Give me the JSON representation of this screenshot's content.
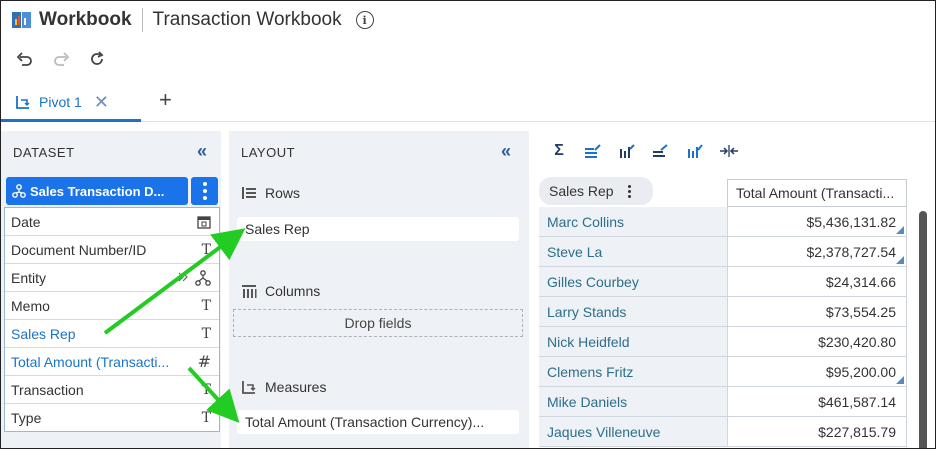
{
  "header": {
    "app_name": "Workbook",
    "doc_title": "Transaction Workbook",
    "info": "i"
  },
  "tabs": {
    "items": [
      {
        "label": "Pivot 1"
      }
    ],
    "add": "+"
  },
  "dataset": {
    "title": "DATASET",
    "collapse": "«",
    "selected": "Sales Transaction D...",
    "fields": [
      {
        "label": "Date",
        "type_icon": "calendar-icon"
      },
      {
        "label": "Document Number/ID",
        "type": "T"
      },
      {
        "label": "Entity",
        "type_icon": "hierarchy-icon"
      },
      {
        "label": "Memo",
        "type": "T"
      },
      {
        "label": "Sales Rep",
        "type": "T"
      },
      {
        "label": "Total Amount (Transacti...",
        "type": "#"
      },
      {
        "label": "Transaction",
        "type": "T"
      },
      {
        "label": "Type",
        "type": "T"
      }
    ]
  },
  "layout": {
    "title": "LAYOUT",
    "collapse": "«",
    "rows_label": "Rows",
    "rows_value": "Sales Rep",
    "columns_label": "Columns",
    "columns_placeholder": "Drop fields",
    "measures_label": "Measures",
    "measures_value": "Total Amount (Transaction Currency)..."
  },
  "results": {
    "row_header": "Sales Rep",
    "col_header": "Total Amount (Transacti...",
    "rows": [
      {
        "name": "Marc Collins",
        "value": "$5,436,131.82"
      },
      {
        "name": "Steve La",
        "value": "$2,378,727.54"
      },
      {
        "name": "Gilles Courbey",
        "value": "$24,314.66"
      },
      {
        "name": "Larry Stands",
        "value": "$73,554.25"
      },
      {
        "name": "Nick Heidfeld",
        "value": "$230,420.80"
      },
      {
        "name": "Clemens Fritz",
        "value": "$95,200.00"
      },
      {
        "name": "Mike Daniels",
        "value": "$461,587.14"
      },
      {
        "name": "Jaques Villeneuve",
        "value": "$227,815.79"
      }
    ],
    "tools": {
      "sum": "Σ"
    }
  },
  "colors": {
    "accent": "#1a73e8",
    "arrow": "#22cc22",
    "panel": "#eef1f5"
  }
}
